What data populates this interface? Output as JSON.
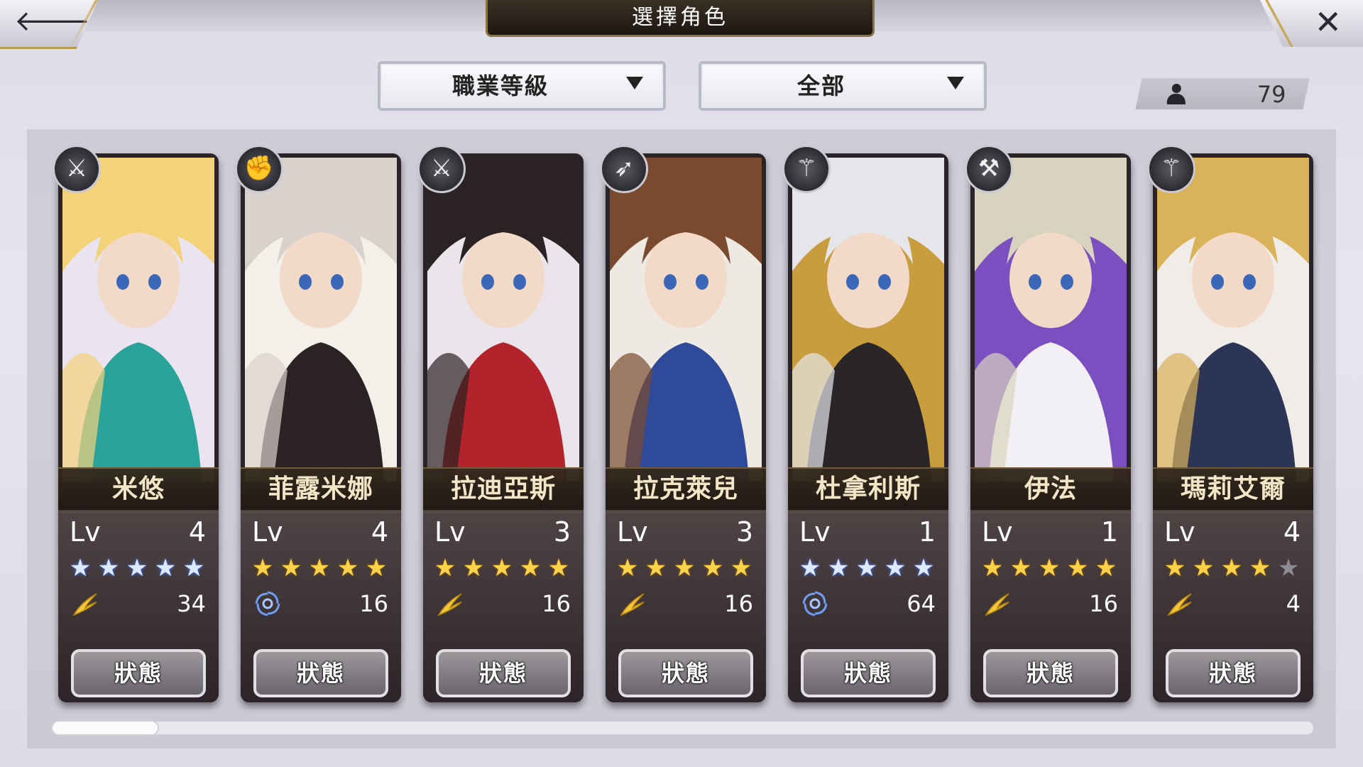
{
  "header": {
    "title": "選擇角色",
    "back_icon": "arrow-left-icon",
    "close_icon": "close-x-icon"
  },
  "filters": {
    "sort": "職業等級",
    "category": "全部"
  },
  "party_count": "79",
  "status_label": "狀態",
  "lv_label": "Lv",
  "characters": [
    {
      "name": "米悠",
      "lv": "4",
      "stars": 5,
      "star_color": "blue",
      "element": "wind-icon",
      "cost": "34",
      "class": "sword-icon",
      "palette": [
        "#f3d27a",
        "#2aa39a",
        "#e9e4f0"
      ]
    },
    {
      "name": "菲露米娜",
      "lv": "4",
      "stars": 5,
      "star_color": "gold",
      "element": "swirl-icon",
      "cost": "16",
      "class": "fist-icon",
      "palette": [
        "#d9d2cc",
        "#2a2225",
        "#f3efe9"
      ]
    },
    {
      "name": "拉迪亞斯",
      "lv": "3",
      "stars": 5,
      "star_color": "gold",
      "element": "wind-icon",
      "cost": "16",
      "class": "sword-icon",
      "palette": [
        "#2b2224",
        "#b3232b",
        "#e9e5ea"
      ]
    },
    {
      "name": "拉克萊兒",
      "lv": "3",
      "stars": 5,
      "star_color": "gold",
      "element": "wind-icon",
      "cost": "16",
      "class": "bow-icon",
      "palette": [
        "#7a4a2e",
        "#2e4a99",
        "#efe9e3"
      ]
    },
    {
      "name": "杜拿利斯",
      "lv": "1",
      "stars": 5,
      "star_color": "blue",
      "element": "swirl-icon",
      "cost": "64",
      "class": "staff-icon",
      "palette": [
        "#e6e6ea",
        "#2a2628",
        "#c79d3e"
      ]
    },
    {
      "name": "伊法",
      "lv": "1",
      "stars": 5,
      "star_color": "gold",
      "element": "wind-icon",
      "cost": "16",
      "class": "hammer-icon",
      "palette": [
        "#d8d3be",
        "#f2f0f4",
        "#7b4fc0"
      ]
    },
    {
      "name": "瑪莉艾爾",
      "lv": "4",
      "stars": 4,
      "star_color": "gold",
      "element": "wind-icon",
      "cost": "4",
      "class": "staff-icon",
      "palette": [
        "#d9b25a",
        "#2c3556",
        "#f0ece8"
      ]
    }
  ],
  "scroll_position": 0
}
